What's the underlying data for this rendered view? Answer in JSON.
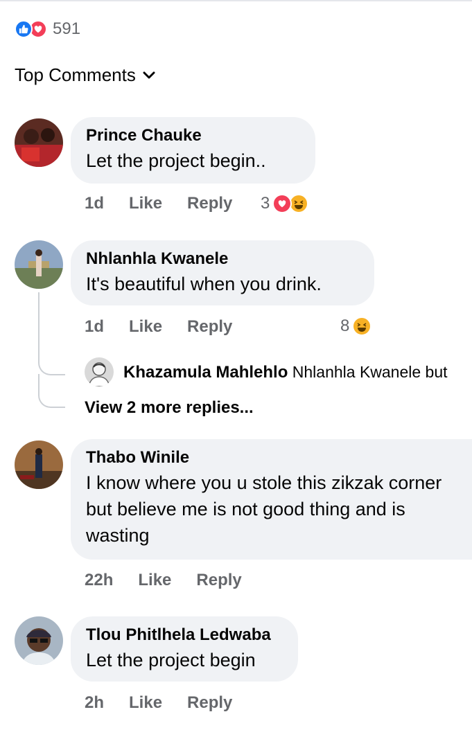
{
  "post_reactions": {
    "count": "591",
    "types": [
      "like-icon",
      "love-icon"
    ]
  },
  "sort": {
    "label": "Top Comments"
  },
  "comments": [
    {
      "author": "Prince Chauke",
      "text": "Let the project begin..",
      "time": "1d",
      "like": "Like",
      "reply": "Reply",
      "reaction_count": "3",
      "reactions": [
        "love-icon",
        "haha-icon"
      ]
    },
    {
      "author": "Nhlanhla Kwanele",
      "text": "It's beautiful when you drink.",
      "time": "1d",
      "like": "Like",
      "reply": "Reply",
      "reaction_count": "8",
      "reactions": [
        "haha-icon"
      ],
      "reply_preview": {
        "author": "Khazamula Mahlehlo",
        "text": "Nhlanhla Kwanele but"
      },
      "view_more": "View 2 more replies..."
    },
    {
      "author": "Thabo Winile",
      "text": "I know where you u stole this zikzak corner but believe me is not good thing and is wasting",
      "time": "22h",
      "like": "Like",
      "reply": "Reply"
    },
    {
      "author": "Tlou Phitlhela Ledwaba",
      "text": "Let the project begin",
      "time": "2h",
      "like": "Like",
      "reply": "Reply"
    }
  ],
  "colors": {
    "bubble": "#f0f2f5",
    "meta": "#65676b",
    "like_blue": "#1877f2",
    "love_red": "#f33e58",
    "haha_yellow": "#f7b125"
  }
}
